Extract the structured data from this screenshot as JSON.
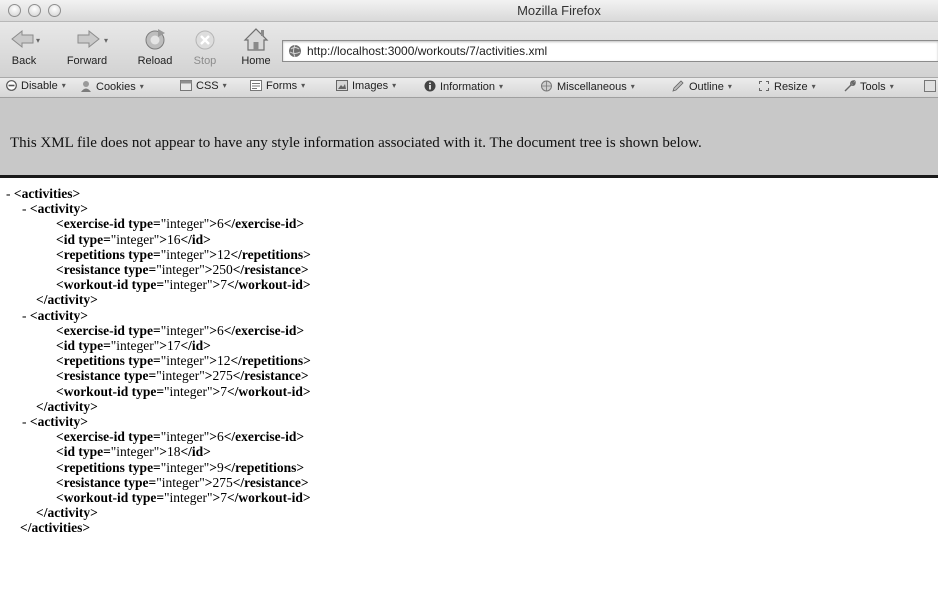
{
  "window": {
    "title": "Mozilla Firefox"
  },
  "nav": {
    "back": "Back",
    "forward": "Forward",
    "reload": "Reload",
    "stop": "Stop",
    "home": "Home",
    "url": "http://localhost:3000/workouts/7/activities.xml"
  },
  "devbar": {
    "items": [
      "Disable",
      "Cookies",
      "CSS",
      "Forms",
      "Images",
      "Information",
      "Miscellaneous",
      "Outline",
      "Resize",
      "Tools"
    ]
  },
  "notice": "This XML file does not appear to have any style information associated with it. The document tree is shown below.",
  "xml": {
    "collapse_marker": "-",
    "root_tag": "activities",
    "child_tag": "activity",
    "type_attr_name": "type",
    "activities": [
      {
        "fields": [
          {
            "tag": "exercise-id",
            "type": "integer",
            "value": "6"
          },
          {
            "tag": "id",
            "type": "integer",
            "value": "16"
          },
          {
            "tag": "repetitions",
            "type": "integer",
            "value": "12"
          },
          {
            "tag": "resistance",
            "type": "integer",
            "value": "250"
          },
          {
            "tag": "workout-id",
            "type": "integer",
            "value": "7"
          }
        ]
      },
      {
        "fields": [
          {
            "tag": "exercise-id",
            "type": "integer",
            "value": "6"
          },
          {
            "tag": "id",
            "type": "integer",
            "value": "17"
          },
          {
            "tag": "repetitions",
            "type": "integer",
            "value": "12"
          },
          {
            "tag": "resistance",
            "type": "integer",
            "value": "275"
          },
          {
            "tag": "workout-id",
            "type": "integer",
            "value": "7"
          }
        ]
      },
      {
        "fields": [
          {
            "tag": "exercise-id",
            "type": "integer",
            "value": "6"
          },
          {
            "tag": "id",
            "type": "integer",
            "value": "18"
          },
          {
            "tag": "repetitions",
            "type": "integer",
            "value": "9"
          },
          {
            "tag": "resistance",
            "type": "integer",
            "value": "275"
          },
          {
            "tag": "workout-id",
            "type": "integer",
            "value": "7"
          }
        ]
      }
    ]
  }
}
